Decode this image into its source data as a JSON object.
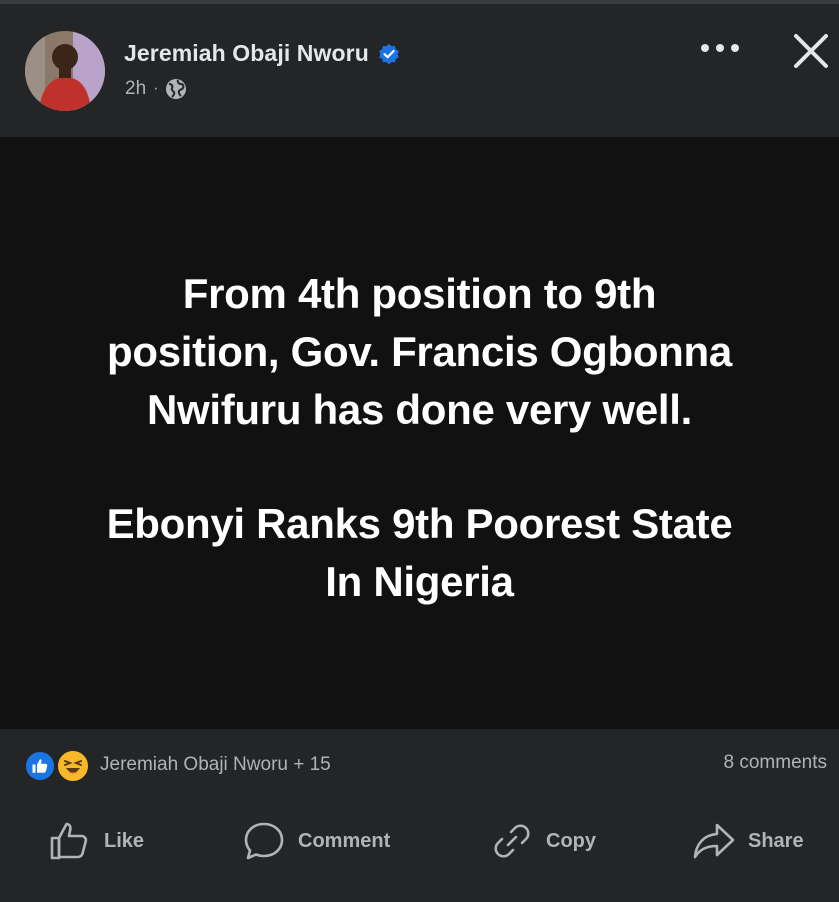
{
  "post": {
    "author": "Jeremiah Obaji Nworu",
    "time": "2h",
    "separator": "·",
    "verified": true,
    "audience_icon": "globe-icon",
    "headline_lines": [
      "From 4th position to 9th",
      "position, Gov. Francis Ogbonna",
      "Nwifuru has done very well."
    ],
    "subline_lines": [
      "Ebonyi Ranks 9th Poorest State",
      "In Nigeria"
    ]
  },
  "reactions": {
    "icons": [
      "like-reaction-icon",
      "haha-reaction-icon"
    ],
    "summary": "Jeremiah Obaji Nworu + 15",
    "comments": "8 comments"
  },
  "actions": {
    "like": "Like",
    "comment": "Comment",
    "copy": "Copy",
    "share": "Share"
  },
  "colors": {
    "background": "#242526",
    "post_background": "#111111",
    "text_primary": "#e4e6eb",
    "text_secondary": "#b0b3b8",
    "accent": "#1b74e4",
    "haha": "#f7b928"
  }
}
